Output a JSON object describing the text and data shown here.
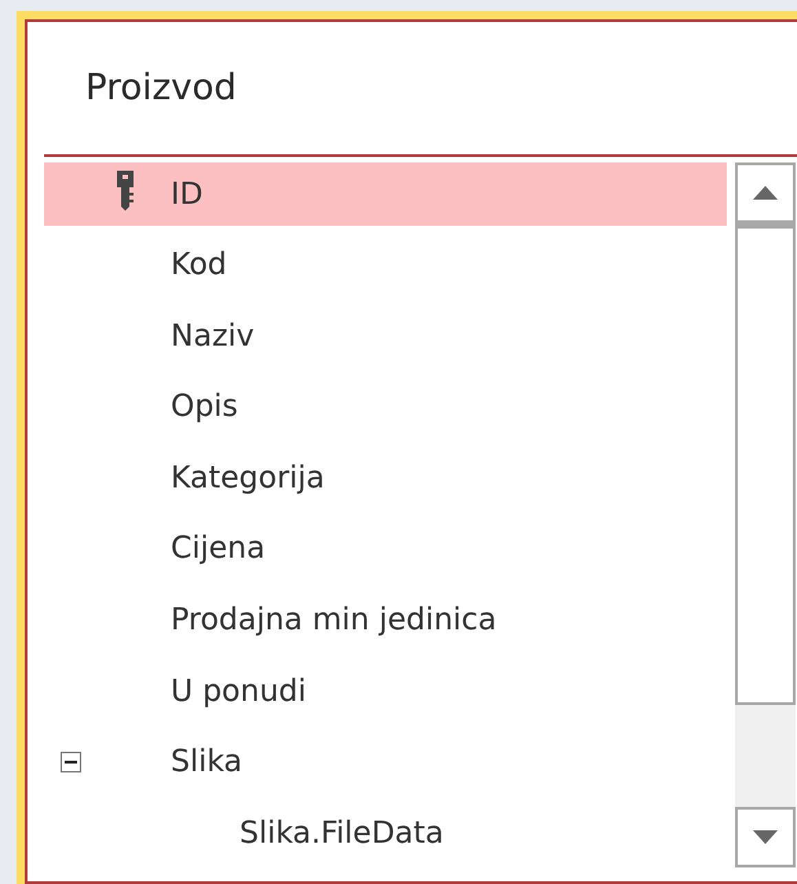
{
  "table": {
    "title": "Proizvod",
    "fields": [
      {
        "name": "ID",
        "primary_key": true,
        "selected": true
      },
      {
        "name": "Kod",
        "primary_key": false,
        "selected": false
      },
      {
        "name": "Naziv",
        "primary_key": false,
        "selected": false
      },
      {
        "name": "Opis",
        "primary_key": false,
        "selected": false
      },
      {
        "name": "Kategorija",
        "primary_key": false,
        "selected": false
      },
      {
        "name": "Cijena",
        "primary_key": false,
        "selected": false
      },
      {
        "name": "Prodajna min jedinica",
        "primary_key": false,
        "selected": false
      },
      {
        "name": "U ponudi",
        "primary_key": false,
        "selected": false
      },
      {
        "name": "Slika",
        "primary_key": false,
        "selected": false,
        "expanded": true,
        "children": [
          {
            "name": "Slika.FileData",
            "primary_key": false,
            "selected": false
          }
        ]
      }
    ]
  }
}
